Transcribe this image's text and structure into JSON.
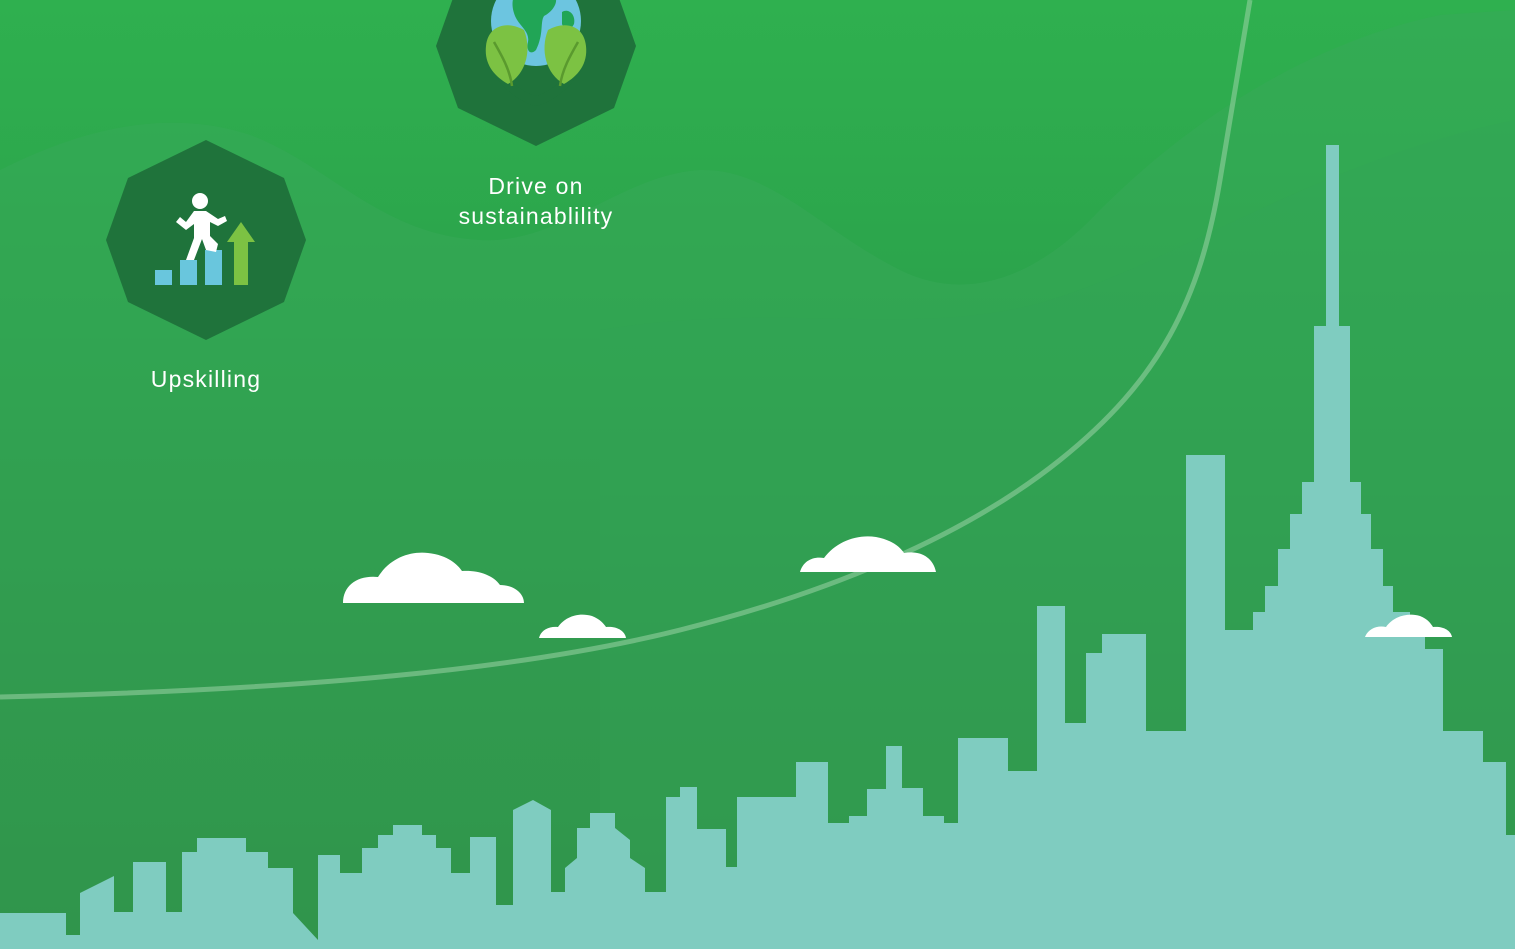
{
  "background": {
    "colors": {
      "top": "#2fb04f",
      "bottom": "#29853f",
      "badge": "#1f733b",
      "skyline": "#7fccc0",
      "cloud": "#ffffff"
    }
  },
  "badges": [
    {
      "icon": "climbing-person-growth-icon",
      "label": "Upskilling"
    },
    {
      "icon": "earth-leaves-icon",
      "label_line1": "Drive on",
      "label_line2": "sustainablility"
    }
  ],
  "decorations": {
    "skyline": "city-skyline",
    "clouds": 4,
    "growth_curve": "rising-curve"
  }
}
